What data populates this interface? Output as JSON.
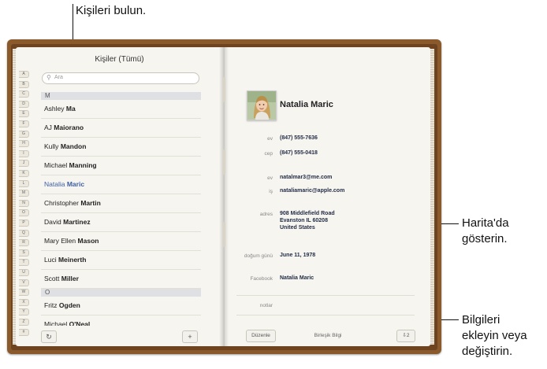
{
  "callouts": {
    "find": "Kişileri bulun.",
    "map_1": "Harita'da",
    "map_2": "gösterin.",
    "edit_1": "Bilgileri",
    "edit_2": "ekleyin veya",
    "edit_3": "değiştirin."
  },
  "contacts": {
    "title": "Kişiler (Tümü)",
    "search_placeholder": "Ara",
    "index_letters": [
      "A",
      "B",
      "C",
      "D",
      "E",
      "F",
      "G",
      "H",
      "I",
      "J",
      "K",
      "L",
      "M",
      "N",
      "O",
      "P",
      "Q",
      "R",
      "S",
      "T",
      "U",
      "V",
      "W",
      "X",
      "Y",
      "Z",
      "#"
    ],
    "section_m": "M",
    "section_o": "O",
    "items": [
      {
        "first": "Ashley",
        "last": "Ma"
      },
      {
        "first": "AJ",
        "last": "Maiorano"
      },
      {
        "first": "Kully",
        "last": "Mandon"
      },
      {
        "first": "Michael",
        "last": "Manning"
      },
      {
        "first": "Natalia",
        "last": "Maric"
      },
      {
        "first": "Christopher",
        "last": "Martin"
      },
      {
        "first": "David",
        "last": "Martinez"
      },
      {
        "first": "Mary Ellen",
        "last": "Mason"
      },
      {
        "first": "Luci",
        "last": "Meinerth"
      },
      {
        "first": "Scott",
        "last": "Miller"
      }
    ],
    "items_o": [
      {
        "first": "Fritz",
        "last": "Ogden"
      },
      {
        "first": "Michael",
        "last": "O'Neal"
      }
    ],
    "refresh_icon": "↻",
    "add_icon": "+"
  },
  "card": {
    "name": "Natalia Maric",
    "fields": [
      {
        "label": "ev",
        "value": "(847) 555-7636"
      },
      {
        "label": "cep",
        "value": "(847) 555-0418"
      },
      {
        "label": "ev",
        "value": "natalmar3@me.com"
      },
      {
        "label": "iş",
        "value": "nataliamaric@apple.com"
      },
      {
        "label": "adres",
        "value": "908 Middlefield Road"
      },
      {
        "label": "doğum günü",
        "value": "June 11, 1978"
      },
      {
        "label": "Facebook",
        "value": "Natalia Maric"
      },
      {
        "label": "notlar",
        "value": ""
      }
    ],
    "address_line2": "Evanston IL 60208",
    "address_line3": "United States",
    "edit_button": "Düzenle",
    "linked_label": "Birleşik Bilgi",
    "share_button": "⇩2"
  }
}
